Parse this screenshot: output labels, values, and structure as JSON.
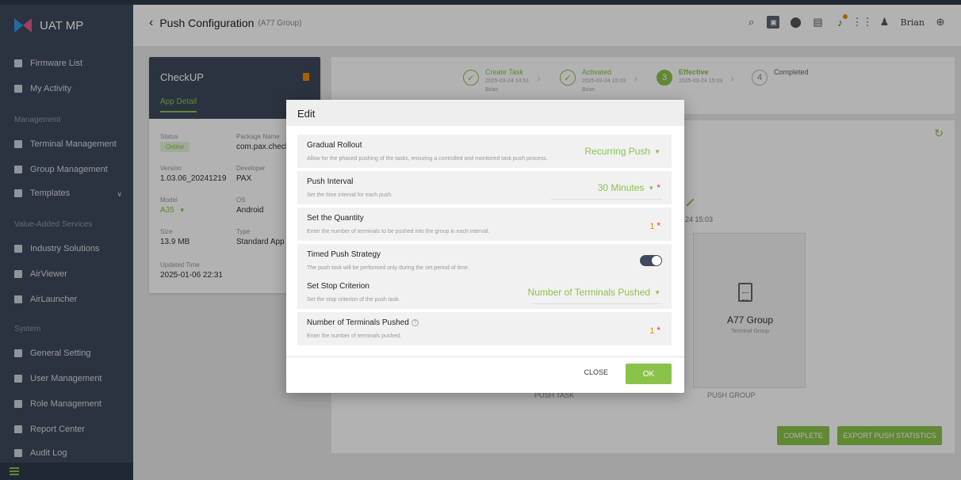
{
  "app": {
    "name": "UAT MP"
  },
  "header": {
    "title": "Push Configuration",
    "subtitle": "(A77 Group)",
    "user": "Brian"
  },
  "sidebar": {
    "items": [
      {
        "label": "Firmware List",
        "icon": "firmware-icon"
      },
      {
        "label": "My Activity",
        "icon": "activity-icon"
      },
      {
        "label": "Terminal Management",
        "icon": "terminal-icon"
      },
      {
        "label": "Group Management",
        "icon": "group-icon"
      },
      {
        "label": "Templates",
        "icon": "template-icon"
      },
      {
        "label": "Industry Solutions",
        "icon": "industry-icon"
      },
      {
        "label": "AirViewer",
        "icon": "airviewer-icon"
      },
      {
        "label": "AirLauncher",
        "icon": "airlauncher-icon"
      },
      {
        "label": "General Setting",
        "icon": "setting-icon"
      },
      {
        "label": "User Management",
        "icon": "user-icon"
      },
      {
        "label": "Role Management",
        "icon": "role-icon"
      },
      {
        "label": "Report Center",
        "icon": "report-icon"
      },
      {
        "label": "Audit Log",
        "icon": "audit-icon"
      }
    ],
    "sections": [
      "Management",
      "Value-Added Services",
      "System"
    ]
  },
  "app_card": {
    "name": "CheckUP",
    "tab": "App Detail",
    "status_label": "Status",
    "status_value": "Online",
    "package_label": "Package Name",
    "package_value": "com.pax.checku",
    "version_label": "Version",
    "version_value": "1.03.06_20241219",
    "developer_label": "Developer",
    "developer_value": "PAX",
    "model_label": "Model",
    "model_value": "A35",
    "os_label": "OS",
    "os_value": "Android",
    "size_label": "Size",
    "size_value": "13.9 MB",
    "type_label": "Type",
    "type_value": "Standard App",
    "updated_label": "Updated Time",
    "updated_value": "2025-01-06 22:31"
  },
  "steps": [
    {
      "num": "✓",
      "title": "Create Task",
      "date": "2025-03-24 14:51",
      "user": "Brian"
    },
    {
      "num": "✓",
      "title": "Activated",
      "date": "2025-03-24 15:03",
      "user": "Brian"
    },
    {
      "num": "3",
      "title": "Effective",
      "date": "2025-03-24 15:03",
      "user": ""
    },
    {
      "num": "4",
      "title": "Completed",
      "date": "",
      "user": ""
    }
  ],
  "main": {
    "date_fragment": "24 15:03",
    "group_name": "A77 Group",
    "group_type": "Terminal Group",
    "push_task": "PUSH TASK",
    "push_group": "PUSH GROUP",
    "complete_btn": "COMPLETE",
    "export_btn": "EXPORT PUSH STATISTICS"
  },
  "modal": {
    "title": "Edit",
    "rows": [
      {
        "label": "Gradual Rollout",
        "desc": "Allow for the phased pushing of the tasks, ensuring a controlled and monitored task push process.",
        "value": "Recurring Push"
      },
      {
        "label": "Push Interval",
        "desc": "Set the time interval for each push.",
        "value": "30 Minutes"
      },
      {
        "label": "Set the Quantity",
        "desc": "Enter the number of terminals to be pushed into the group in each interval.",
        "value": "1"
      },
      {
        "label": "Timed Push Strategy",
        "desc": "The push task will be performed only during the set period of time.",
        "value": ""
      },
      {
        "label": "Set Stop Criterion",
        "desc": "Set the stop criterion of the push task.",
        "value": "Number of Terminals Pushed"
      },
      {
        "label": "Number of Terminals Pushed",
        "desc": "Enter the number of terminals pushed.",
        "value": "1"
      }
    ],
    "close_btn": "CLOSE",
    "ok_btn": "OK"
  },
  "colors": {
    "accent": "#8bc34a",
    "sidebar": "#3f4a5c",
    "warning": "#f08c00",
    "required": "#e53935"
  }
}
